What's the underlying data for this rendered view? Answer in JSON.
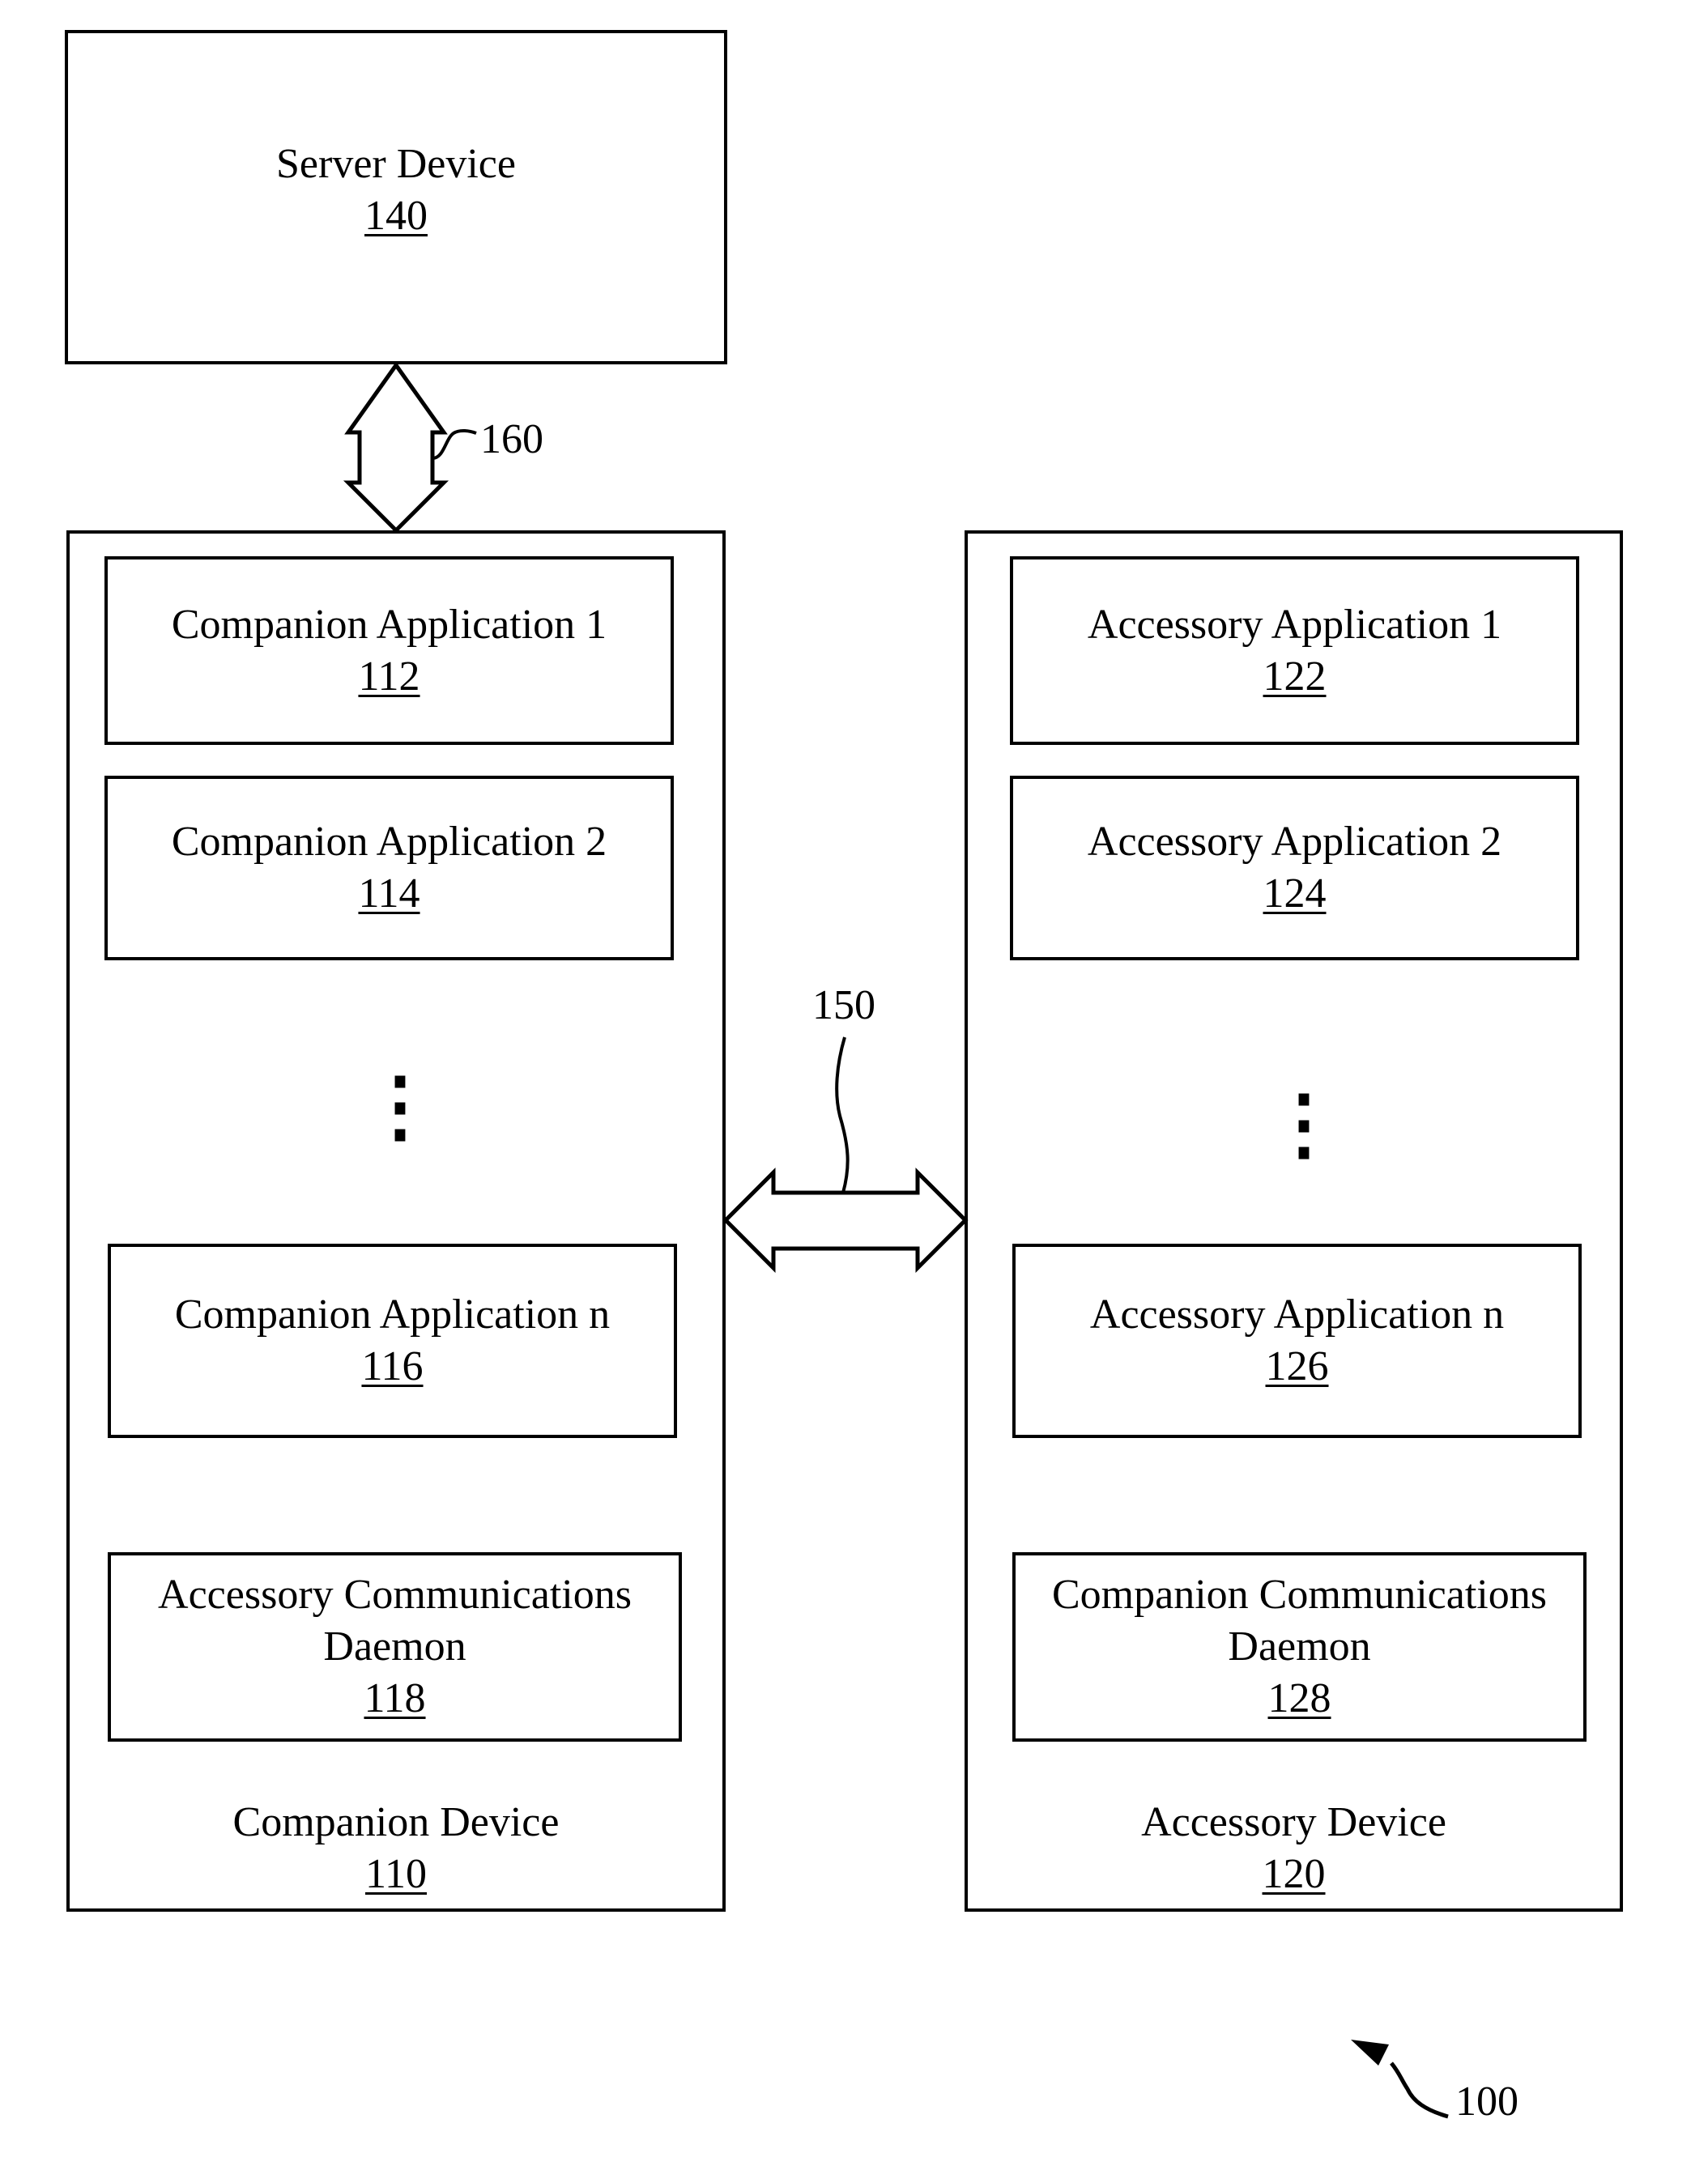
{
  "server": {
    "title": "Server Device",
    "ref": "140"
  },
  "companion_device": {
    "title": "Companion Device",
    "ref": "110",
    "apps": [
      {
        "title": "Companion Application 1",
        "ref": "112"
      },
      {
        "title": "Companion Application 2",
        "ref": "114"
      },
      {
        "title": "Companion Application n",
        "ref": "116"
      }
    ],
    "daemon": {
      "title_line1": "Accessory Communications",
      "title_line2": "Daemon",
      "ref": "118"
    }
  },
  "accessory_device": {
    "title": "Accessory Device",
    "ref": "120",
    "apps": [
      {
        "title": "Accessory Application 1",
        "ref": "122"
      },
      {
        "title": "Accessory Application 2",
        "ref": "124"
      },
      {
        "title": "Accessory Application n",
        "ref": "126"
      }
    ],
    "daemon": {
      "title_line1": "Companion Communications",
      "title_line2": "Daemon",
      "ref": "128"
    }
  },
  "connections": {
    "server_link_ref": "160",
    "device_link_ref": "150"
  },
  "figure_ref": "100",
  "ellipsis": "⋮"
}
